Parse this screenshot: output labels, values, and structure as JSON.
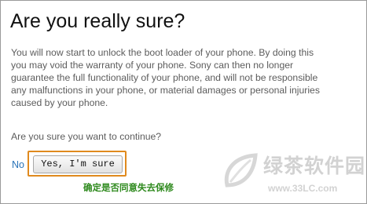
{
  "dialog": {
    "title": "Are you really sure?",
    "body_lines": [
      "You will now start to unlock the boot loader of your phone. By doing this",
      "you may void the warranty of your phone. Sony can then no longer",
      "guarantee the full functionality of your phone, and will not be responsible",
      "any malfunctions in your phone, or material damages or personal injuries",
      "caused by your phone."
    ],
    "question": "Are you sure you want to continue?",
    "no_label": "No",
    "yes_label": "Yes, I'm sure",
    "annotation": "确定是否同意失去保修"
  },
  "watermark": {
    "site_name": "绿茶软件园",
    "url": "www.33LC.com"
  },
  "colors": {
    "link": "#2a73b8",
    "highlight_border": "#e08a1e",
    "annotation": "#2f8a1e",
    "body_text": "#5c5c5c"
  },
  "icons": [
    "leaf-logo-icon"
  ]
}
